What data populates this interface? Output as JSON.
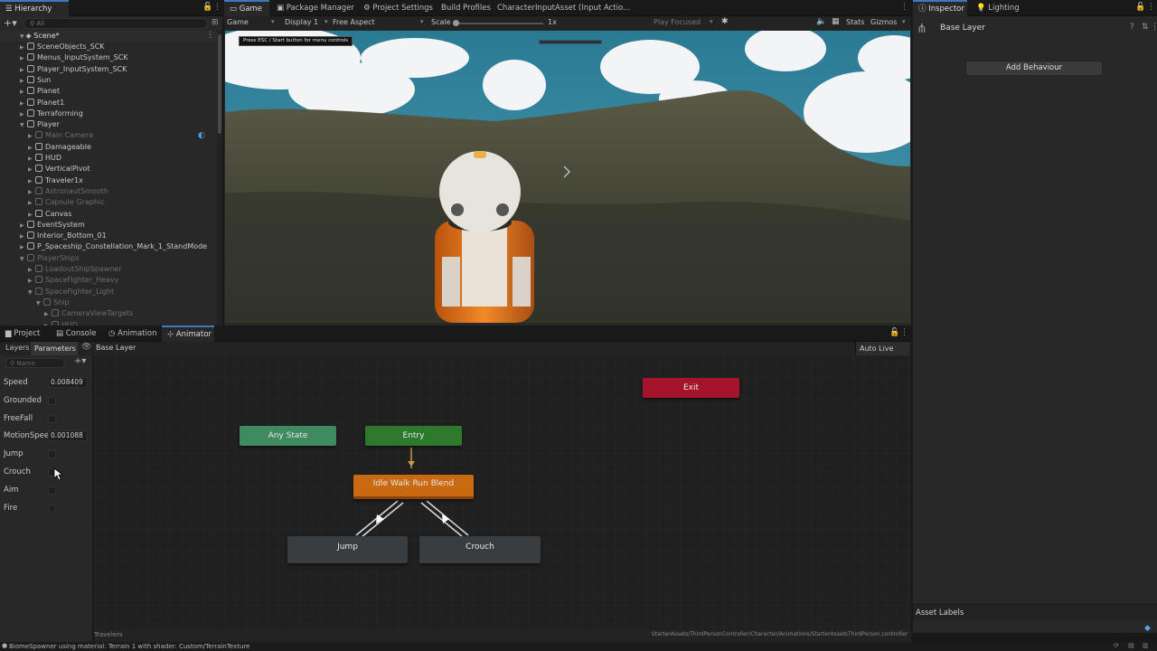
{
  "hierarchy": {
    "tab_label": "Hierarchy",
    "search_placeholder": "All",
    "scene_name": "Scene*",
    "items": [
      {
        "label": "SceneObjects_SCK",
        "depth": 1,
        "dim": false
      },
      {
        "label": "Menus_InputSystem_SCK",
        "depth": 1,
        "dim": false
      },
      {
        "label": "Player_InputSystem_SCK",
        "depth": 1,
        "dim": false
      },
      {
        "label": "Sun",
        "depth": 1,
        "dim": false
      },
      {
        "label": "Planet",
        "depth": 1,
        "dim": false
      },
      {
        "label": "Planet1",
        "depth": 1,
        "dim": false
      },
      {
        "label": "Terraforming",
        "depth": 1,
        "dim": false
      },
      {
        "label": "Player",
        "depth": 1,
        "dim": false
      },
      {
        "label": "Main Camera",
        "depth": 2,
        "dim": true
      },
      {
        "label": "Damageable",
        "depth": 2,
        "dim": false
      },
      {
        "label": "HUD",
        "depth": 2,
        "dim": false
      },
      {
        "label": "VerticalPivot",
        "depth": 2,
        "dim": false
      },
      {
        "label": "Traveler1x",
        "depth": 2,
        "dim": false
      },
      {
        "label": "AstronautSmooth",
        "depth": 2,
        "dim": true
      },
      {
        "label": "Capsule Graphic",
        "depth": 2,
        "dim": true
      },
      {
        "label": "Canvas",
        "depth": 2,
        "dim": false
      },
      {
        "label": "EventSystem",
        "depth": 1,
        "dim": false
      },
      {
        "label": "Interior_Bottom_01",
        "depth": 1,
        "dim": false
      },
      {
        "label": "P_Spaceship_Constellation_Mark_1_StandMode",
        "depth": 1,
        "dim": false
      },
      {
        "label": "PlayerShips",
        "depth": 1,
        "dim": true
      },
      {
        "label": "LoadoutShipSpawner",
        "depth": 2,
        "dim": true
      },
      {
        "label": "SpaceFighter_Heavy",
        "depth": 2,
        "dim": true
      },
      {
        "label": "SpaceFighter_Light",
        "depth": 2,
        "dim": true
      },
      {
        "label": "Ship",
        "depth": 3,
        "dim": true
      },
      {
        "label": "CameraViewTargets",
        "depth": 4,
        "dim": true
      },
      {
        "label": "HUD",
        "depth": 4,
        "dim": true
      }
    ]
  },
  "center_tabs": [
    "Game",
    "Package Manager",
    "Project Settings",
    "Build Profiles",
    "CharacterInputAsset (Input Actio..."
  ],
  "game_toolbar": {
    "mode": "Game",
    "display": "Display 1",
    "aspect": "Free Aspect",
    "scale_label": "Scale",
    "scale_value": "1x",
    "play_focused": "Play Focused",
    "stats": "Stats",
    "gizmos": "Gizmos"
  },
  "game_view": {
    "hint_text": "Press ESC / Start button for menu controls"
  },
  "bottom_tabs": [
    "Project",
    "Console",
    "Animation",
    "Animator"
  ],
  "animator": {
    "layers_tab": "Layers",
    "parameters_tab": "Parameters",
    "breadcrumb": "Base Layer",
    "auto_live_link": "Auto Live Link",
    "search_placeholder": "Name",
    "parameters": [
      {
        "name": "Speed",
        "type": "float",
        "value": "0.008409"
      },
      {
        "name": "Grounded",
        "type": "bool"
      },
      {
        "name": "FreeFall",
        "type": "bool"
      },
      {
        "name": "MotionSpeed",
        "type": "float",
        "value": "0.001088"
      },
      {
        "name": "Jump",
        "type": "bool"
      },
      {
        "name": "Crouch",
        "type": "bool"
      },
      {
        "name": "Aim",
        "type": "bool"
      },
      {
        "name": "Fire",
        "type": "trigger"
      }
    ],
    "nodes": {
      "exit": "Exit",
      "any_state": "Any State",
      "entry": "Entry",
      "idle": "Idle Walk Run Blend",
      "jump": "Jump",
      "crouch": "Crouch"
    },
    "status_path_left": "Travelers",
    "status_path_right": "StarterAssets/ThirdPersonController/Character/Animations/StarterAssetsThirdPerson.controller"
  },
  "inspector": {
    "tab_label": "Inspector",
    "lighting_tab": "Lighting",
    "title": "Base Layer",
    "add_behaviour": "Add Behaviour",
    "asset_labels": "Asset Labels"
  },
  "status_bar": {
    "message": "BiomeSpawner using material: Terrain 1 with shader: Custom/TerrainTexture"
  },
  "colors": {
    "exit_node": "#a5142a",
    "entry_node": "#2d7a2d",
    "any_state_node": "#3f8a5e",
    "idle_node": "#c96a12",
    "default_node": "#3a3d40",
    "accent": "#3a79bb"
  }
}
